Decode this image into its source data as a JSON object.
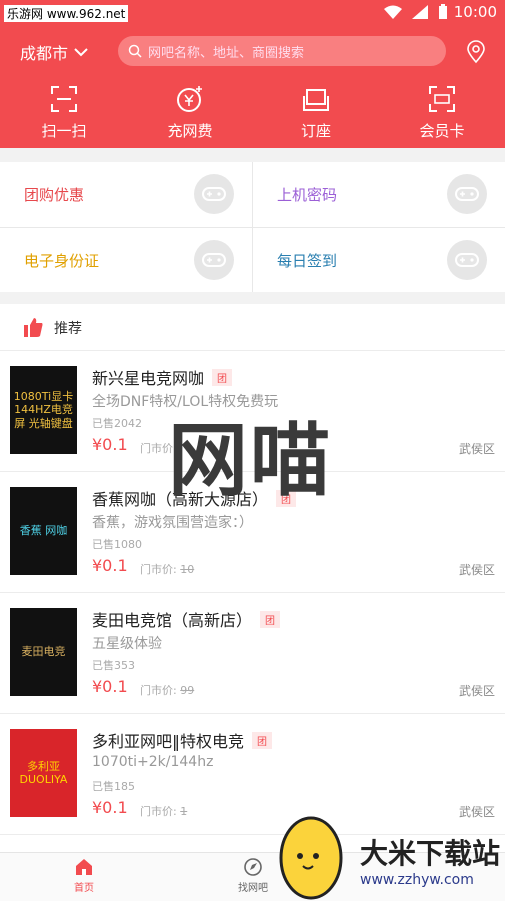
{
  "watermark_top": "乐游网 www.962.net",
  "status": {
    "time": "10:00"
  },
  "header": {
    "city": "成都市",
    "search_placeholder": "网吧名称、地址、商圈搜索",
    "actions": [
      {
        "label": "扫一扫",
        "icon": "scan-icon"
      },
      {
        "label": "充网费",
        "icon": "yuan-plus-icon"
      },
      {
        "label": "订座",
        "icon": "seat-icon"
      },
      {
        "label": "会员卡",
        "icon": "card-scan-icon"
      }
    ]
  },
  "colors": {
    "brand": "#f24b4f",
    "teal": "#2a7fb0",
    "purple": "#9b5fd6",
    "orange": "#e0a000",
    "red": "#e7484c"
  },
  "grid": [
    {
      "label": "团购优惠",
      "color": "#e7484c"
    },
    {
      "label": "上机密码",
      "color": "#9b5fd6"
    },
    {
      "label": "电子身份证",
      "color": "#e0a000"
    },
    {
      "label": "每日签到",
      "color": "#2a7fb0"
    }
  ],
  "recommend": {
    "title": "推荐"
  },
  "items": [
    {
      "name": "新兴星电竞网咖",
      "tag": "团",
      "desc": "全场DNF特权/LOL特权免费玩",
      "sold": "已售2042",
      "price": "¥0.1",
      "market_label": "门市价:",
      "market_value": "",
      "area": "武侯区",
      "logo_text": "1080Ti显卡 144HZ电竞屏 光轴键盘"
    },
    {
      "name": "香蕉网咖（高新大源店）",
      "tag": "团",
      "desc": "香蕉，游戏氛围营造家：）",
      "sold": "已售1080",
      "price": "¥0.1",
      "market_label": "门市价:",
      "market_value": "10",
      "area": "武侯区",
      "logo_text": "香蕉 网咖"
    },
    {
      "name": "麦田电竞馆（高新店）",
      "tag": "团",
      "desc": "五星级体验",
      "sold": "已售353",
      "price": "¥0.1",
      "market_label": "门市价:",
      "market_value": "99",
      "area": "武侯区",
      "logo_text": "麦田电竞"
    },
    {
      "name": "多利亚网吧‖特权电竞",
      "tag": "团",
      "desc": "1070ti+2k/144hz",
      "sold": "已售185",
      "price": "¥0.1",
      "market_label": "门市价:",
      "market_value": "1",
      "area": "武侯区",
      "logo_text": "多利亚 DUOLIYA"
    }
  ],
  "watermark_center": "网喵",
  "tabs": [
    {
      "label": "首页",
      "icon": "home-icon",
      "active": true
    },
    {
      "label": "找网吧",
      "icon": "find-icon",
      "active": false
    }
  ],
  "site_badge": {
    "title": "大米下载站",
    "url": "www.zzhyw.com"
  }
}
